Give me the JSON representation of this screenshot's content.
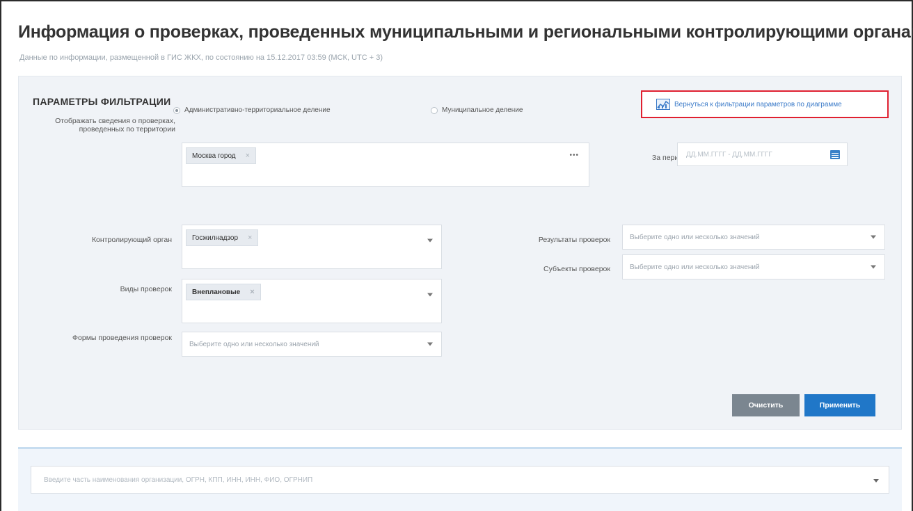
{
  "page": {
    "title": "Информация о проверках, проведенных муниципальными и региональными контролирующими органами",
    "subtitle": "Данные по информации, размещенной в ГИС ЖКХ, по состоянию на 15.12.2017 03:59 (МСК, UTC + 3)"
  },
  "filters": {
    "heading": "ПАРАМЕТРЫ ФИЛЬТРАЦИИ",
    "diagram_link": "Вернуться к фильтрации параметров по диаграмме",
    "division": {
      "options": [
        "Административно-территориальное деление",
        "Муниципальное деление"
      ],
      "selected": 0
    },
    "territory": {
      "label": "Отображать сведения о проверках, проведенных по территории",
      "tag": "Москва город"
    },
    "period": {
      "label": "За период",
      "placeholder": "ДД.ММ.ГГГГ - ДД.ММ.ГГГГ"
    },
    "control_body": {
      "label": "Контролирующий орган",
      "tag": "Госжилнадзор"
    },
    "inspection_types": {
      "label": "Виды проверок",
      "tag": "Внеплановые"
    },
    "inspection_forms": {
      "label": "Формы проведения проверок",
      "placeholder": "Выберите одно или несколько значений"
    },
    "results": {
      "label": "Результаты проверок",
      "placeholder": "Выберите одно или несколько значений"
    },
    "subjects": {
      "label": "Субъекты проверок",
      "placeholder": "Выберите одно или несколько значений"
    },
    "buttons": {
      "clear": "Очистить",
      "apply": "Применить"
    }
  },
  "search": {
    "placeholder": "Введите часть наименования организации, ОГРН, КПП, ИНН, ИНН, ФИО, ОГРНИП"
  },
  "colors": {
    "accent_blue": "#2077c8",
    "clear_gray": "#7b8690",
    "highlight_red": "#e02030",
    "panel_bg": "#f0f3f7"
  },
  "icons": {
    "diagram_link": "chart-icon",
    "period": "calendar-icon",
    "dropdown": "chevron-down-icon",
    "territory_more": "ellipsis-icon",
    "tag_remove": "close-icon"
  }
}
